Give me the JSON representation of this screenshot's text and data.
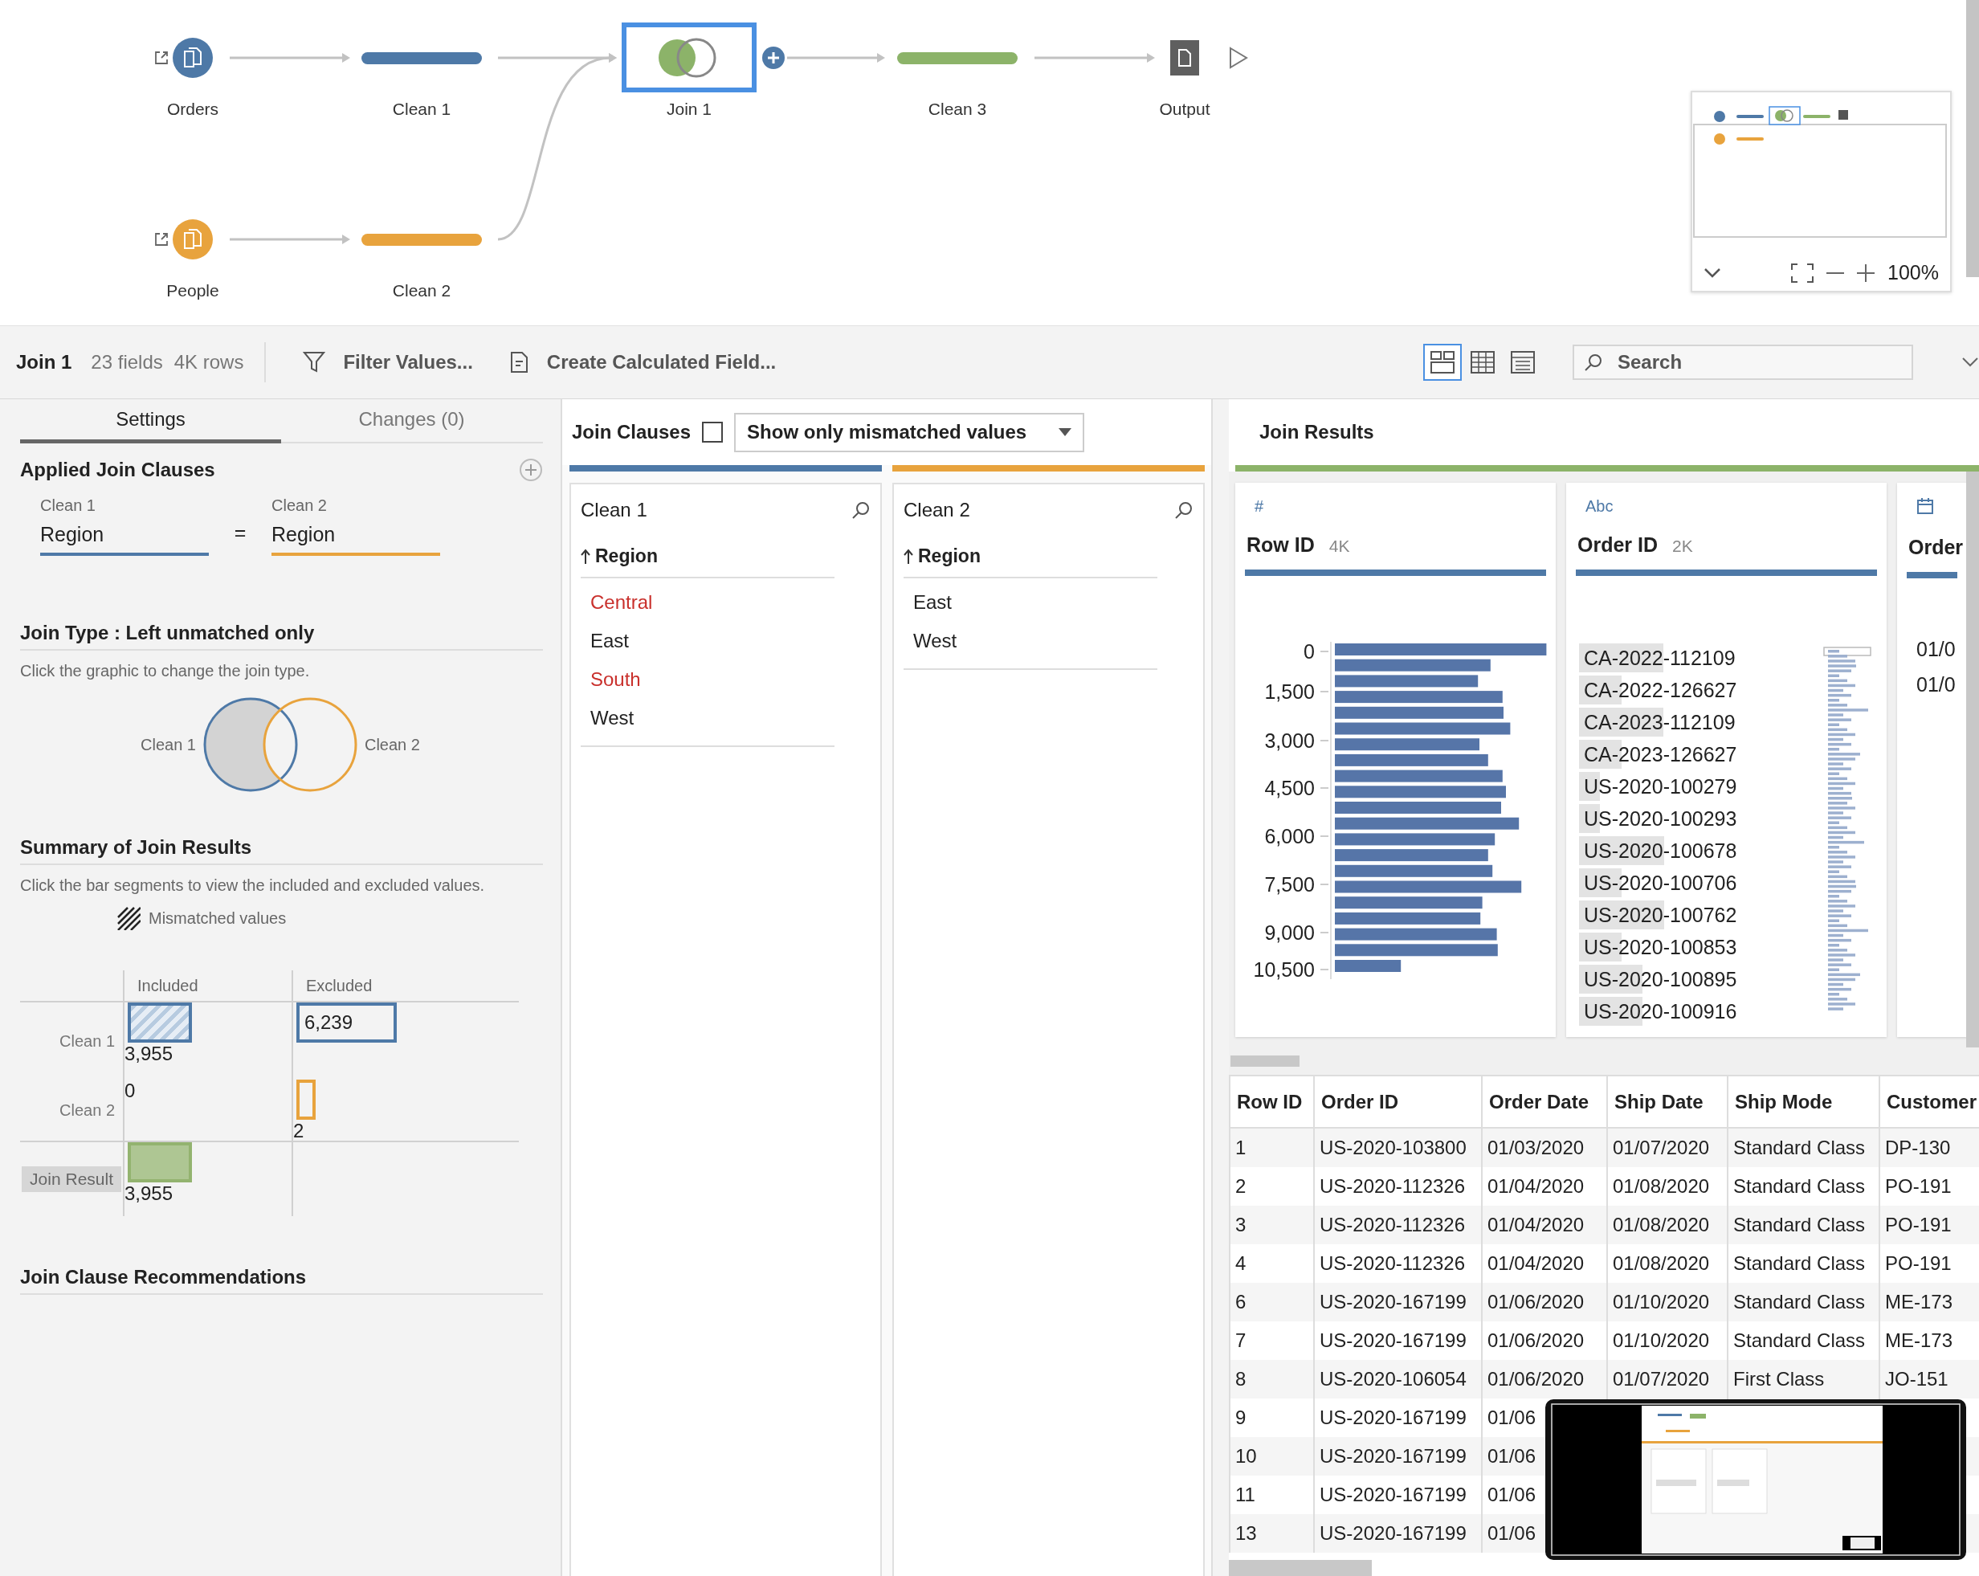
{
  "flow": {
    "nodes": [
      {
        "label": "Orders",
        "kind": "input",
        "color": "#4e79a7",
        "selected": false
      },
      {
        "label": "Clean 1",
        "kind": "clean",
        "color": "#4e79a7",
        "selected": false
      },
      {
        "label": "Join 1",
        "kind": "join",
        "color": "#8cb369",
        "selected": true
      },
      {
        "label": "Clean 3",
        "kind": "clean",
        "color": "#8cb369",
        "selected": false
      },
      {
        "label": "Output",
        "kind": "output",
        "color": "#5f5f5f",
        "selected": false
      },
      {
        "label": "People",
        "kind": "input",
        "color": "#e8a33d",
        "selected": false
      },
      {
        "label": "Clean 2",
        "kind": "clean",
        "color": "#e8a33d",
        "selected": false
      }
    ],
    "minimap": {
      "zoom": "100%"
    }
  },
  "toolbar": {
    "step": "Join 1",
    "fields": "23 fields",
    "rows": "4K rows",
    "actions": [
      "Filter Values...",
      "Create Calculated Field..."
    ],
    "views": [
      {
        "kind": "cards",
        "selected": true
      },
      {
        "kind": "grid",
        "selected": false
      },
      {
        "kind": "list",
        "selected": false
      }
    ],
    "search": {
      "placeholder": "Search"
    }
  },
  "settings_panel": {
    "tabs": [
      {
        "label": "Settings",
        "selected": true
      },
      {
        "label": "Changes (0)",
        "selected": false
      }
    ],
    "applied_join_clauses": {
      "title": "Applied Join Clauses",
      "left_label": "Clean 1",
      "right_label": "Clean 2",
      "left_field": "Region",
      "operator": "=",
      "right_field": "Region"
    },
    "join_type": {
      "title": "Join Type : Left unmatched only",
      "hint": "Click the graphic to change the join type.",
      "left_label": "Clean 1",
      "right_label": "Clean 2"
    },
    "summary": {
      "title": "Summary of Join Results",
      "hint": "Click the bar segments to view the included and excluded values.",
      "legend": "Mismatched values",
      "columns": [
        "Included",
        "Excluded"
      ],
      "rows": [
        {
          "label": "Clean 1",
          "color": "#4e79a7",
          "included": {
            "value": "3,955",
            "kind": "hatched"
          },
          "excluded": {
            "value": "6,239",
            "kind": "labeled"
          }
        },
        {
          "label": "Clean 2",
          "color": "#e8a33d",
          "included": {
            "value": "0",
            "kind": "none"
          },
          "excluded": {
            "value": "2",
            "kind": "outline"
          }
        }
      ],
      "result": {
        "label": "Join Result",
        "color": "#93b36f",
        "included": {
          "value": "3,955",
          "kind": "filled"
        }
      }
    },
    "recommendations": {
      "title": "Join Clause Recommendations"
    }
  },
  "join_clauses": {
    "title": "Join Clauses",
    "checkbox": {
      "checked": false
    },
    "dropdown": {
      "value": "Show only mismatched values"
    },
    "sides": [
      {
        "name": "Clean 1",
        "color": "#4e79a7",
        "field": "Region",
        "values": [
          {
            "text": "Central",
            "mismatched": true
          },
          {
            "text": "East",
            "mismatched": false
          },
          {
            "text": "South",
            "mismatched": true
          },
          {
            "text": "West",
            "mismatched": false
          }
        ]
      },
      {
        "name": "Clean 2",
        "color": "#e8a33d",
        "field": "Region",
        "values": [
          {
            "text": "East",
            "mismatched": false
          },
          {
            "text": "West",
            "mismatched": false
          }
        ]
      }
    ]
  },
  "join_results": {
    "title": "Join Results",
    "color": "#8cb369",
    "profiles": [
      {
        "kind": "number",
        "type_label": "#",
        "name": "Row ID",
        "count": "4K",
        "axis_labels": [
          "0",
          "1,500",
          "3,000",
          "4,500",
          "6,000",
          "7,500",
          "9,000",
          "10,500"
        ]
      },
      {
        "kind": "string",
        "type_label": "Abc",
        "name": "Order ID",
        "count": "2K",
        "values": [
          {
            "text": "CA-2022-112109",
            "level": 0.54
          },
          {
            "text": "CA-2022-126627",
            "level": 0.27
          },
          {
            "text": "CA-2023-112109",
            "level": 0.54
          },
          {
            "text": "CA-2023-126627",
            "level": 0.27
          },
          {
            "text": "US-2020-100279",
            "level": 0.13
          },
          {
            "text": "US-2020-100293",
            "level": 0.13
          },
          {
            "text": "US-2020-100678",
            "level": 0.54
          },
          {
            "text": "US-2020-100706",
            "level": 0.27
          },
          {
            "text": "US-2020-100762",
            "level": 0.54
          },
          {
            "text": "US-2020-100853",
            "level": 0.27
          },
          {
            "text": "US-2020-100895",
            "level": 0.4
          },
          {
            "text": "US-2020-100916",
            "level": 0.4
          }
        ]
      },
      {
        "kind": "date",
        "name": "Order",
        "values": [
          {
            "text": "01/0"
          },
          {
            "text": "01/0"
          }
        ]
      }
    ]
  },
  "table": {
    "columns": [
      "Row ID",
      "Order ID",
      "Order Date",
      "Ship Date",
      "Ship Mode",
      "Customer"
    ],
    "rows": [
      [
        "1",
        "US-2020-103800",
        "01/03/2020",
        "01/07/2020",
        "Standard Class",
        "DP-130"
      ],
      [
        "2",
        "US-2020-112326",
        "01/04/2020",
        "01/08/2020",
        "Standard Class",
        "PO-191"
      ],
      [
        "3",
        "US-2020-112326",
        "01/04/2020",
        "01/08/2020",
        "Standard Class",
        "PO-191"
      ],
      [
        "4",
        "US-2020-112326",
        "01/04/2020",
        "01/08/2020",
        "Standard Class",
        "PO-191"
      ],
      [
        "6",
        "US-2020-167199",
        "01/06/2020",
        "01/10/2020",
        "Standard Class",
        "ME-173"
      ],
      [
        "7",
        "US-2020-167199",
        "01/06/2020",
        "01/10/2020",
        "Standard Class",
        "ME-173"
      ],
      [
        "8",
        "US-2020-106054",
        "01/06/2020",
        "01/07/2020",
        "First Class",
        "JO-151"
      ],
      [
        "9",
        "US-2020-167199",
        "01/06"
      ],
      [
        "10",
        "US-2020-167199",
        "01/06"
      ],
      [
        "11",
        "US-2020-167199",
        "01/06"
      ],
      [
        "13",
        "US-2020-167199",
        "01/06"
      ]
    ]
  }
}
